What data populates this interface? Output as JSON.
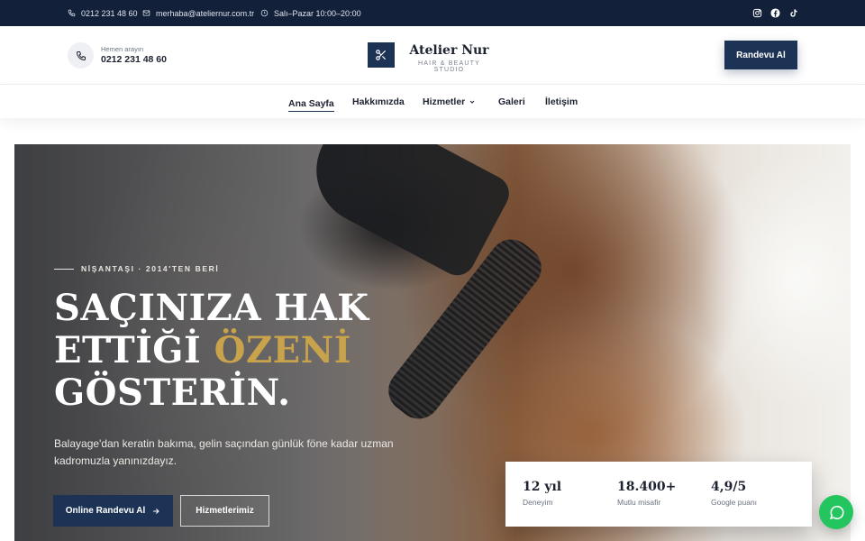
{
  "topbar": {
    "phone": "0212 231 48 60",
    "email": "merhaba@ateliernur.com.tr",
    "hours": "Salı–Pazar 10:00–20:00",
    "socials": [
      "instagram-icon",
      "facebook-icon",
      "tiktok-icon"
    ]
  },
  "header": {
    "call_label": "Hemen arayın",
    "call_number": "0212 231 48 60",
    "logo_icon": "scissors-icon",
    "brand_name": "Atelier Nur",
    "brand_tagline": "HAIR & BEAUTY STUDIO",
    "cta_label": "Randevu Al"
  },
  "nav": {
    "items": [
      {
        "label": "Ana Sayfa",
        "active": true
      },
      {
        "label": "Hakkımızda"
      },
      {
        "label": "Hizmetler",
        "dropdown": true
      },
      {
        "label": "Galeri"
      },
      {
        "label": "İletişim"
      }
    ]
  },
  "hero": {
    "eyebrow": "NİŞANTAŞI · 2014'TEN BERİ",
    "title_line1": "SAÇINIZA HAK",
    "title_line2_a": "ETTİĞİ ",
    "title_line2_highlight": "ÖZENİ",
    "title_line3": "GÖSTERİN.",
    "lead": "Balayage'dan keratin bakıma, gelin saçından günlük föne kadar uzman kadromuzla yanınızdayız.",
    "primary_button": "Online Randevu Al",
    "secondary_button": "Hizmetlerimiz"
  },
  "stats": [
    {
      "value": "12 yıl",
      "label": "Deneyim"
    },
    {
      "value": "18.400+",
      "label": "Mutlu misafir"
    },
    {
      "value": "4,9/5",
      "label": "Google puanı"
    }
  ],
  "colors": {
    "navy": "#1d3355",
    "topbar": "#132039",
    "gold": "#c9a24c",
    "whatsapp": "#22c55e"
  },
  "floating": {
    "icon": "whatsapp-icon"
  }
}
